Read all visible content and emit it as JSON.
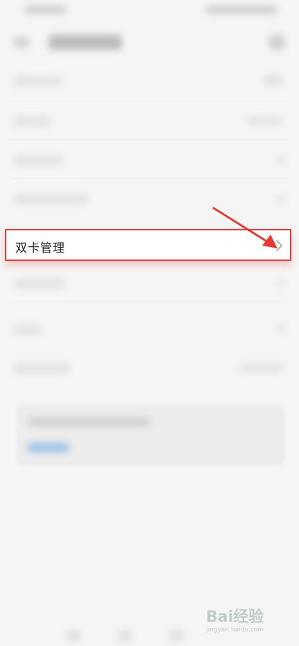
{
  "highlighted_item": {
    "label": "双卡管理"
  },
  "watermark": {
    "logo": "Bai经验",
    "url": "jingyan.baidu.com"
  },
  "colors": {
    "highlight_border": "#e53935",
    "background": "#f5f5f5",
    "card_button": "#9fc3ea"
  },
  "icons": {
    "back": "back-arrow-icon",
    "search": "search-icon",
    "chevron": "chevron-right-icon"
  }
}
